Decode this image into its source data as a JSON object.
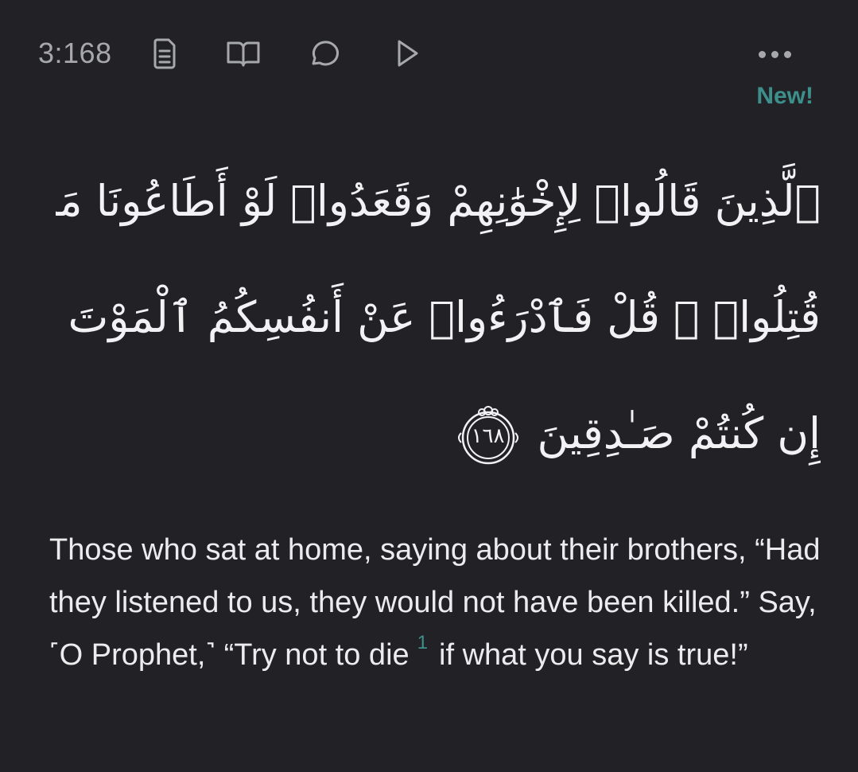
{
  "toolbar": {
    "verse_key": "3:168",
    "icons": [
      "document-icon",
      "book-open-icon",
      "comment-icon",
      "play-icon",
      "more-icon"
    ],
    "icon_color": "#a7a8ac"
  },
  "badge": {
    "new_label": "New!",
    "color": "#3d8f8c"
  },
  "arabic": {
    "line1": "ٱلَّذِينَ قَالُوا۟ لِإِخْوَٰنِهِمْ وَقَعَدُوا۟ لَوْ أَطَاعُونَا مَا",
    "line2": "قُتِلُوا۟ ۗ قُلْ فَٱدْرَءُوا۟ عَنْ أَنفُسِكُمُ ٱلْمَوْتَ",
    "line3": "إِن كُنتُمْ صَـٰدِقِينَ",
    "ayah_number": "١٦٨"
  },
  "translation": {
    "text_before_footnote": "Those who sat at home, saying about their brothers, “Had they listened to us, they would not have been killed.” Say, ˹O Prophet,˺ “Try not to die",
    "footnote_marker": "1",
    "text_after_footnote": "if what you say is true!”",
    "footnote_color": "#3d8f8c"
  },
  "colors": {
    "background": "#222226",
    "text": "#f2f2f4",
    "muted": "#a7a8ac",
    "accent": "#3d8f8c"
  }
}
